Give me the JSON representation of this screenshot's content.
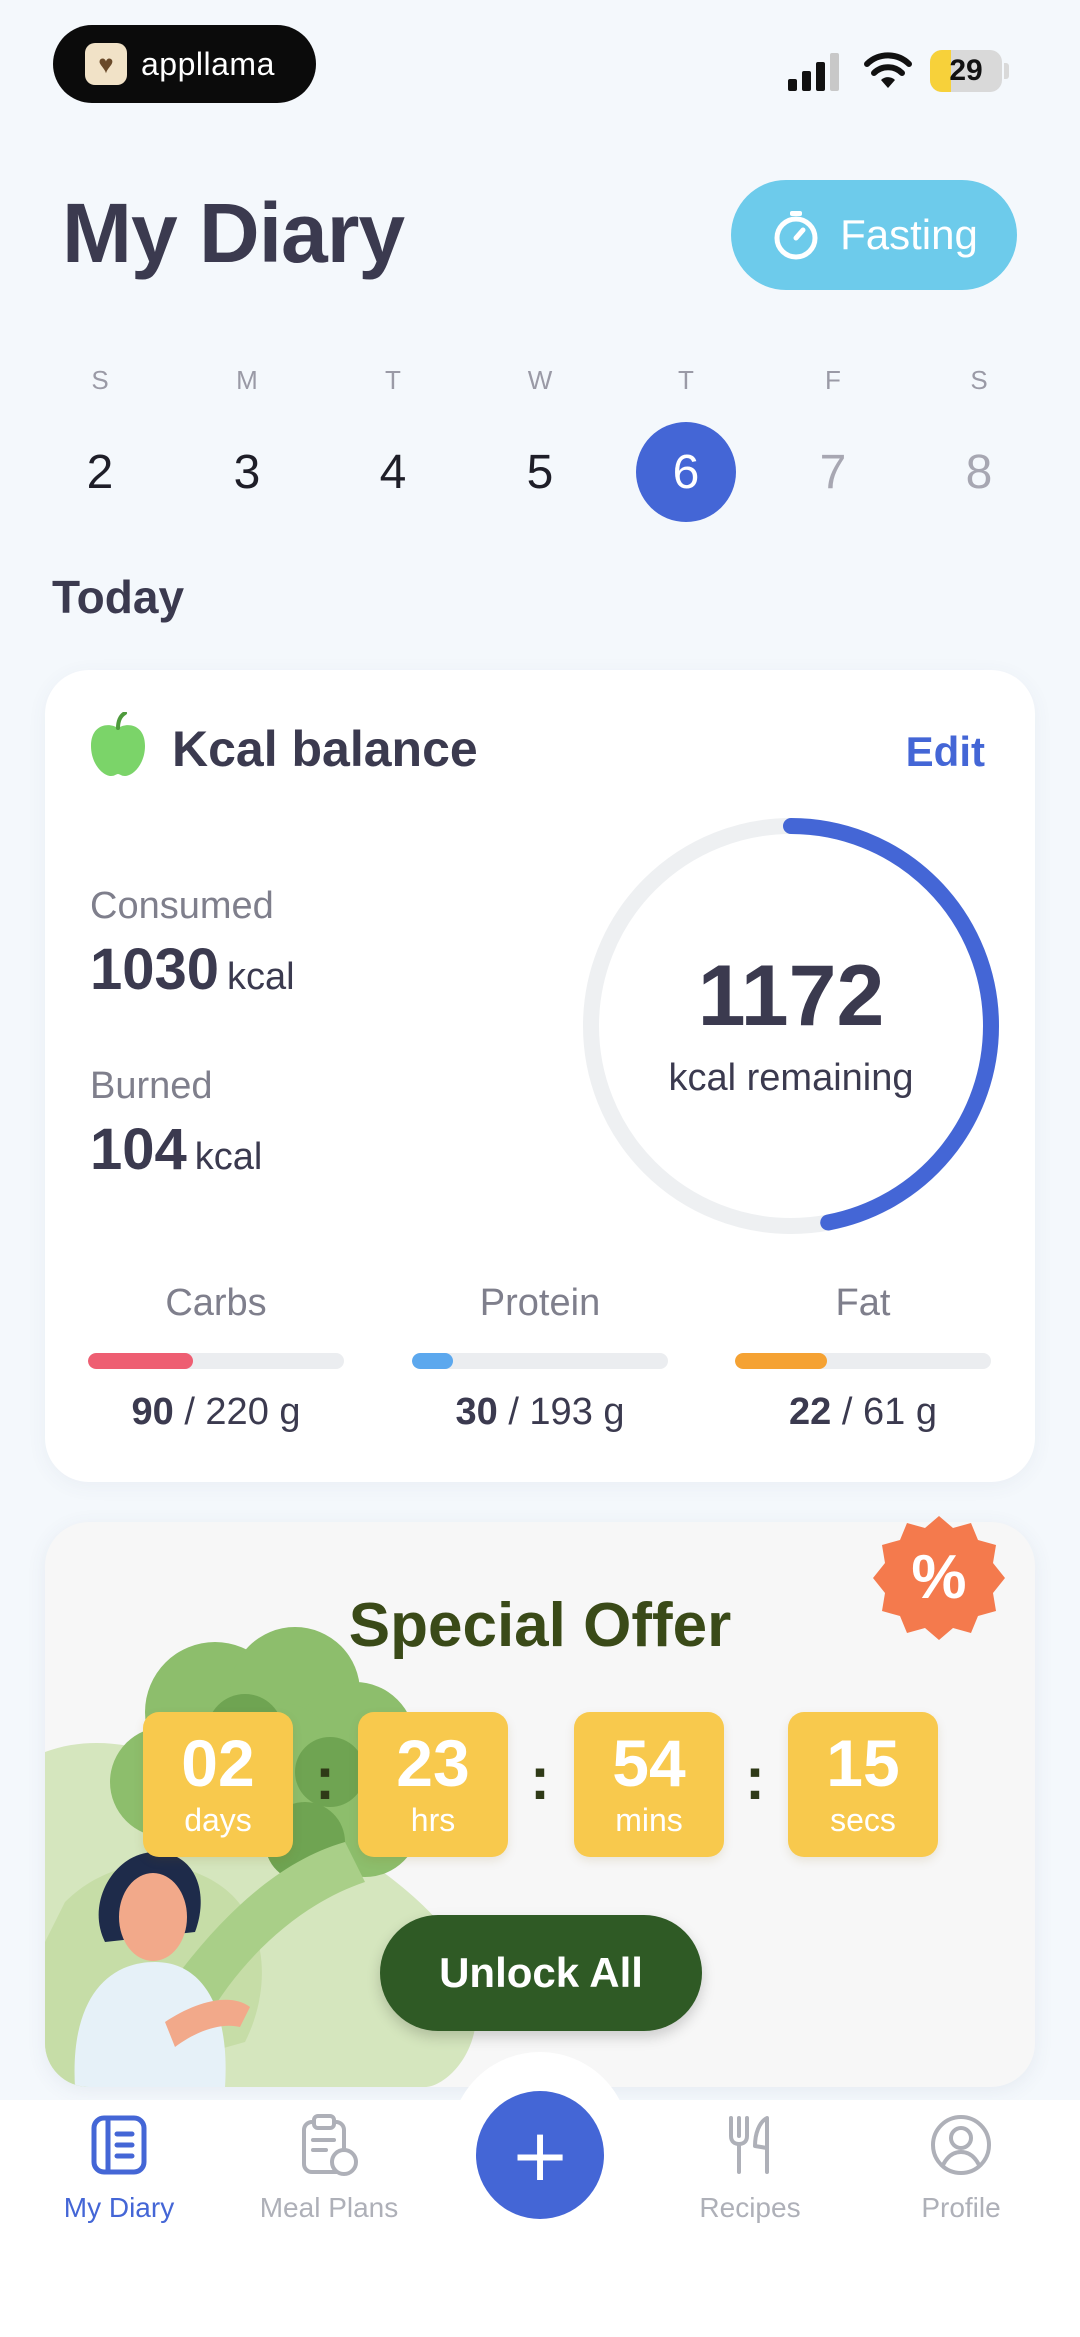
{
  "status_bar": {
    "brand_name": "appllama",
    "battery_level": "29",
    "battery_fraction": 0.29
  },
  "header": {
    "title": "My Diary",
    "fasting_label": "Fasting"
  },
  "week": {
    "days": [
      {
        "letter": "S",
        "number": "2",
        "state": "past"
      },
      {
        "letter": "M",
        "number": "3",
        "state": "past"
      },
      {
        "letter": "T",
        "number": "4",
        "state": "past"
      },
      {
        "letter": "W",
        "number": "5",
        "state": "past"
      },
      {
        "letter": "T",
        "number": "6",
        "state": "selected"
      },
      {
        "letter": "F",
        "number": "7",
        "state": "future"
      },
      {
        "letter": "S",
        "number": "8",
        "state": "future"
      }
    ]
  },
  "today_label": "Today",
  "kcal_card": {
    "title": "Kcal balance",
    "edit_label": "Edit",
    "consumed_label": "Consumed",
    "consumed_value": "1030",
    "consumed_unit": "kcal",
    "burned_label": "Burned",
    "burned_value": "104",
    "burned_unit": "kcal",
    "remaining_value": "1172",
    "remaining_label": "kcal remaining",
    "remaining_fraction": 0.47,
    "ring_color": "#4466D6",
    "macros": [
      {
        "name": "Carbs",
        "current": "90",
        "target": "/ 220 g",
        "fraction": 0.41,
        "color": "#EE5E72"
      },
      {
        "name": "Protein",
        "current": "30",
        "target": "/ 193 g",
        "fraction": 0.16,
        "color": "#5CA8EE"
      },
      {
        "name": "Fat",
        "current": "22",
        "target": "/ 61 g",
        "fraction": 0.36,
        "color": "#F5A233"
      }
    ]
  },
  "offer": {
    "title": "Special Offer",
    "badge_symbol": "%",
    "timer": [
      {
        "value": "02",
        "unit": "days"
      },
      {
        "value": "23",
        "unit": "hrs"
      },
      {
        "value": "54",
        "unit": "mins"
      },
      {
        "value": "15",
        "unit": "secs"
      }
    ],
    "separator": ":",
    "unlock_label": "Unlock All"
  },
  "bottom_nav": {
    "items": [
      {
        "label": "My Diary",
        "icon": "diary-icon",
        "active": true
      },
      {
        "label": "Meal Plans",
        "icon": "meal-plans-icon",
        "active": false
      },
      {
        "label": "Recipes",
        "icon": "fork-knife-icon",
        "active": false
      },
      {
        "label": "Profile",
        "icon": "profile-icon",
        "active": false
      }
    ],
    "add_symbol": "+"
  }
}
